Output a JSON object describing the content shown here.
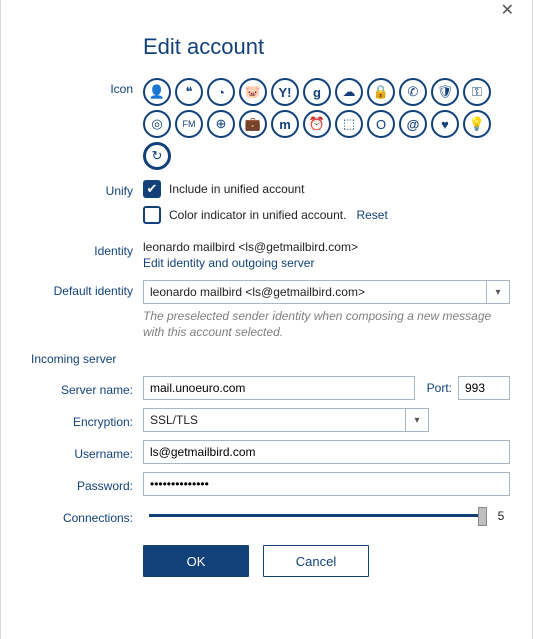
{
  "title": "Edit account",
  "labels": {
    "icon": "Icon",
    "unify": "Unify",
    "identity": "Identity",
    "default_identity": "Default identity",
    "incoming_server": "Incoming server",
    "server_name": "Server name:",
    "port": "Port:",
    "encryption": "Encryption:",
    "username": "Username:",
    "password": "Password:",
    "connections": "Connections:"
  },
  "icons": [
    "person-icon",
    "quote-icon",
    "circle-icon",
    "piggy-icon",
    "yahoo-icon",
    "google-icon",
    "cloud-icon",
    "lock-icon",
    "phone-icon",
    "shield-icon",
    "key-icon",
    "target-icon",
    "fm-icon",
    "globe-icon",
    "briefcase-icon",
    "m-icon",
    "clock-icon",
    "cube-icon",
    "outlook-icon",
    "at-icon",
    "heart-icon",
    "bulb-icon",
    "refresh-icon"
  ],
  "selected_icon": "refresh-icon",
  "unify": {
    "include_label": "Include in unified account",
    "include_checked": true,
    "color_label": "Color indicator in unified account.",
    "color_checked": false,
    "reset": "Reset"
  },
  "identity": {
    "value": "leonardo mailbird <ls@getmailbird.com>",
    "edit_link": "Edit identity and outgoing server"
  },
  "default_identity": {
    "value": "leonardo mailbird <ls@getmailbird.com>",
    "help": "The preselected sender identity when composing a new message with this account selected."
  },
  "incoming": {
    "server": "mail.unoeuro.com",
    "port": "993",
    "encryption": "SSL/TLS",
    "username": "ls@getmailbird.com",
    "password": "••••••••••••••",
    "connections": "5"
  },
  "buttons": {
    "ok": "OK",
    "cancel": "Cancel"
  }
}
